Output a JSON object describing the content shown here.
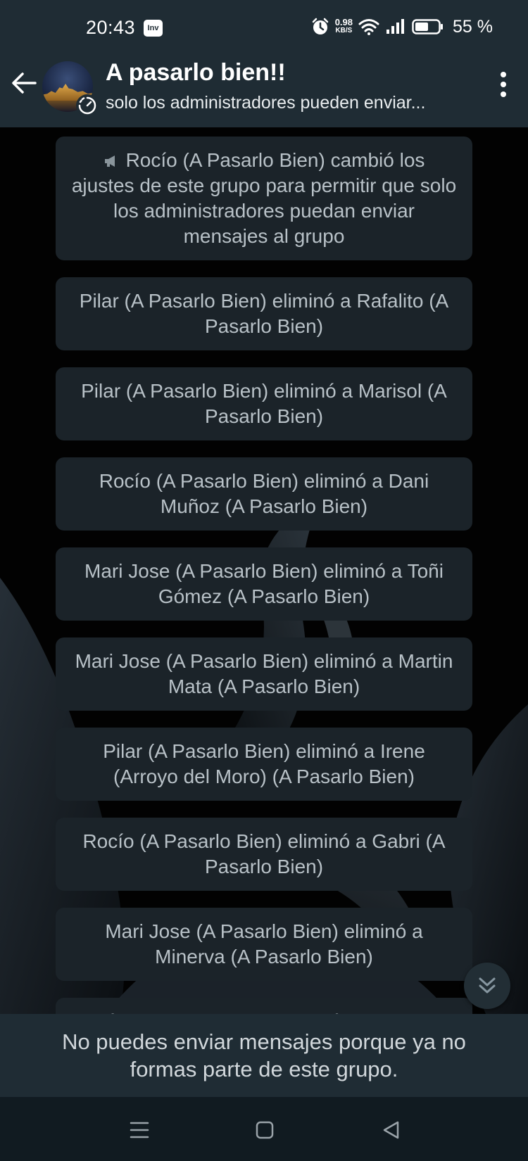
{
  "status_bar": {
    "time": "20:43",
    "app_indicator": "Inv",
    "speed_value": "0.98",
    "speed_unit": "KB/S",
    "battery_percent": "55 %",
    "icons": [
      "alarm-icon",
      "wifi-icon",
      "signal-icon",
      "battery-icon"
    ]
  },
  "header": {
    "title": "A pasarlo bien!!",
    "subtitle": "solo los administradores pueden enviar...",
    "icons": [
      "back-arrow-icon",
      "group-avatar",
      "disappearing-timer-icon",
      "more-options-icon"
    ]
  },
  "messages": [
    {
      "icon": "megaphone-icon",
      "text": "Rocío (A Pasarlo Bien) cambió los ajustes de este grupo para permitir que solo los administradores puedan enviar mensajes al grupo"
    },
    {
      "text": "Pilar (A Pasarlo Bien) eliminó a Rafalito (A Pasarlo Bien)"
    },
    {
      "text": "Pilar (A Pasarlo Bien) eliminó a Marisol (A Pasarlo Bien)"
    },
    {
      "text": "Rocío (A Pasarlo Bien) eliminó a Dani Muñoz (A Pasarlo Bien)"
    },
    {
      "text": "Mari Jose (A Pasarlo Bien) eliminó a Toñi Gómez (A Pasarlo Bien)"
    },
    {
      "text": "Mari Jose (A Pasarlo Bien) eliminó a Martin Mata (A Pasarlo Bien)"
    },
    {
      "text": "Pilar (A Pasarlo Bien) eliminó a Irene (Arroyo del Moro) (A Pasarlo Bien)"
    },
    {
      "text": "Rocío (A Pasarlo Bien) eliminó a Gabri (A Pasarlo Bien)"
    },
    {
      "text": "Mari Jose (A Pasarlo Bien) eliminó a Minerva (A Pasarlo Bien)"
    },
    {
      "text": "Rocío (A Pasarlo Bien) eliminó a Javi Pl (La Batidora)"
    }
  ],
  "footer": {
    "notice": "No puedes enviar mensajes porque ya no formas parte de este grupo."
  },
  "navbar": {
    "icons": [
      "recent-apps-icon",
      "home-icon",
      "back-icon"
    ]
  },
  "colors": {
    "header_bg": "#1f2c34",
    "bubble_bg": "#1b2329",
    "bubble_text": "#b8c1c7",
    "nav_bg": "#111b21"
  }
}
